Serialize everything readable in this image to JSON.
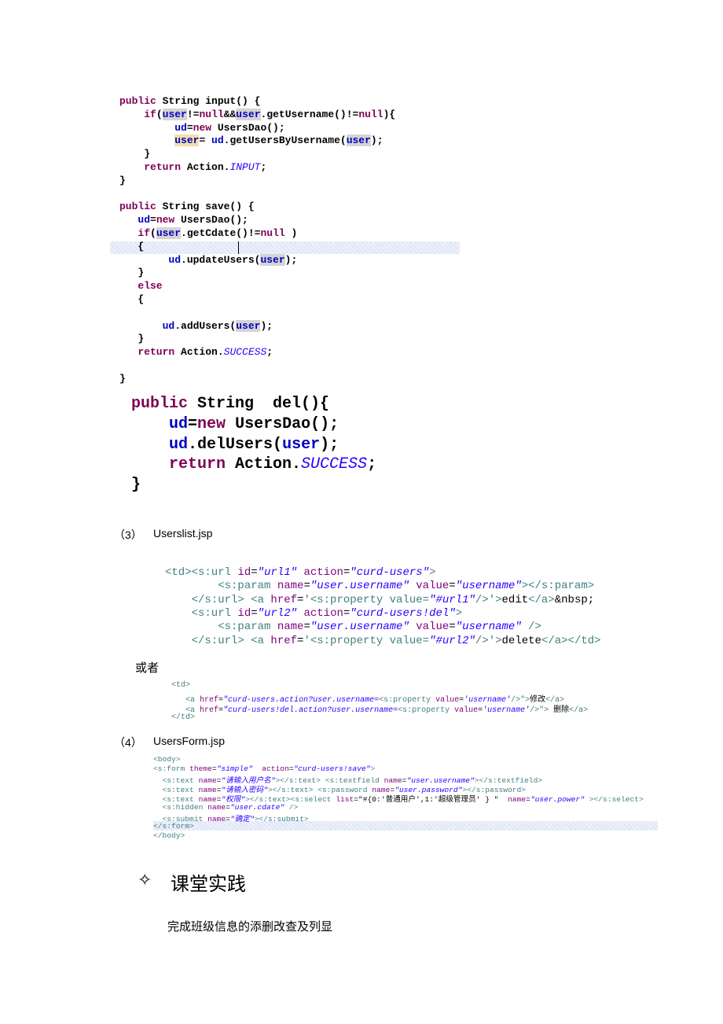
{
  "code_java_1": [
    [
      [
        "public",
        "kw"
      ],
      [
        " String input() {",
        "plain"
      ]
    ],
    [
      [
        "    ",
        "plain"
      ],
      [
        "if",
        "kw"
      ],
      [
        "(",
        "plain"
      ],
      [
        "user",
        "fld hl"
      ],
      [
        "!=",
        "plain"
      ],
      [
        "null",
        "kw"
      ],
      [
        "&&",
        "plain"
      ],
      [
        "user",
        "fld hl"
      ],
      [
        ".getUsername()!=",
        "plain"
      ],
      [
        "null",
        "kw"
      ],
      [
        "){",
        "plain"
      ]
    ],
    [
      [
        "         ",
        "plain"
      ],
      [
        "ud",
        "fld"
      ],
      [
        "=",
        "plain"
      ],
      [
        "new",
        "kw"
      ],
      [
        " UsersDao();",
        "plain"
      ]
    ],
    [
      [
        "         ",
        "plain"
      ],
      [
        "user",
        "fld hlo"
      ],
      [
        "= ",
        "plain"
      ],
      [
        "ud",
        "fld"
      ],
      [
        ".getUsersByUsername(",
        "plain"
      ],
      [
        "user",
        "fld hl"
      ],
      [
        ");",
        "plain"
      ]
    ],
    [
      [
        "    }",
        "plain"
      ]
    ],
    [
      [
        "    ",
        "plain"
      ],
      [
        "return",
        "kw"
      ],
      [
        " Action.",
        "plain"
      ],
      [
        "INPUT",
        "it"
      ],
      [
        ";",
        "plain"
      ]
    ],
    [
      [
        "}",
        "plain"
      ]
    ],
    [
      [
        "",
        "plain"
      ]
    ],
    [
      [
        "public",
        "kw"
      ],
      [
        " String save() {",
        "plain"
      ]
    ],
    [
      [
        "   ",
        "plain"
      ],
      [
        "ud",
        "fld"
      ],
      [
        "=",
        "plain"
      ],
      [
        "new",
        "kw"
      ],
      [
        " UsersDao();",
        "plain"
      ]
    ],
    [
      [
        "   ",
        "plain"
      ],
      [
        "if",
        "kw"
      ],
      [
        "(",
        "plain"
      ],
      [
        "user",
        "fld hl"
      ],
      [
        ".getCdate()!=",
        "plain"
      ],
      [
        "null",
        "kw"
      ],
      [
        " )",
        "plain"
      ]
    ],
    [
      [
        "   {",
        "plain"
      ]
    ],
    [
      [
        "        ",
        "plain"
      ],
      [
        "ud",
        "fld"
      ],
      [
        ".updateUsers(",
        "plain"
      ],
      [
        "user",
        "fld hl"
      ],
      [
        ");",
        "plain"
      ]
    ],
    [
      [
        "   }",
        "plain"
      ]
    ],
    [
      [
        "   ",
        "plain"
      ],
      [
        "else",
        "kw"
      ]
    ],
    [
      [
        "   {",
        "plain"
      ]
    ],
    [
      [
        "",
        "plain"
      ]
    ],
    [
      [
        "       ",
        "plain"
      ],
      [
        "ud",
        "fld"
      ],
      [
        ".addUsers(",
        "plain"
      ],
      [
        "user",
        "fld hl"
      ],
      [
        ");",
        "plain"
      ]
    ],
    [
      [
        "   }",
        "plain"
      ]
    ],
    [
      [
        "   ",
        "plain"
      ],
      [
        "return",
        "kw"
      ],
      [
        " Action.",
        "plain"
      ],
      [
        "SUCCESS",
        "it"
      ],
      [
        ";",
        "plain"
      ]
    ],
    [
      [
        "",
        "plain"
      ]
    ],
    [
      [
        "}",
        "plain"
      ]
    ]
  ],
  "code_java_del": [
    [
      [
        "public",
        "kw"
      ],
      [
        " String  del(){",
        "plain"
      ]
    ],
    [
      [
        "    ",
        "plain"
      ],
      [
        "ud",
        "fld"
      ],
      [
        "=",
        "plain"
      ],
      [
        "new",
        "kw"
      ],
      [
        " UsersDao();",
        "plain"
      ]
    ],
    [
      [
        "    ",
        "plain"
      ],
      [
        "ud",
        "fld"
      ],
      [
        ".delUsers(",
        "plain"
      ],
      [
        "user",
        "fld"
      ],
      [
        ");",
        "plain"
      ]
    ],
    [
      [
        "    ",
        "plain"
      ],
      [
        "return",
        "kw"
      ],
      [
        " Action.",
        "plain"
      ],
      [
        "SUCCESS",
        "it"
      ],
      [
        ";",
        "plain"
      ]
    ],
    [
      [
        "}",
        "plain"
      ]
    ]
  ],
  "section3": {
    "number": "（3）",
    "title": "Userslist.jsp"
  },
  "code_jsp_list": [
    [
      [
        "<td><s:url ",
        "tag"
      ],
      [
        "id",
        "attr"
      ],
      [
        "=",
        "plain"
      ],
      [
        "\"url1\"",
        "str"
      ],
      [
        " ",
        "plain"
      ],
      [
        "action",
        "attr"
      ],
      [
        "=",
        "plain"
      ],
      [
        "\"curd-users\"",
        "str"
      ],
      [
        ">",
        "tag"
      ]
    ],
    [
      [
        "        <s:param ",
        "tag"
      ],
      [
        "name",
        "attr"
      ],
      [
        "=",
        "plain"
      ],
      [
        "\"user.username\"",
        "str"
      ],
      [
        " ",
        "plain"
      ],
      [
        "value",
        "attr"
      ],
      [
        "=",
        "plain"
      ],
      [
        "\"username\"",
        "str"
      ],
      [
        "></s:param>",
        "tag"
      ]
    ],
    [
      [
        "    </s:url> <a ",
        "tag"
      ],
      [
        "href",
        "attr"
      ],
      [
        "=",
        "plain"
      ],
      [
        "'<s:property value=",
        "tag"
      ],
      [
        "\"#url1\"",
        "str"
      ],
      [
        "/>'",
        "tag"
      ],
      [
        ">",
        "tag"
      ],
      [
        "edit",
        "plain"
      ],
      [
        "</a>",
        "tag"
      ],
      [
        "&nbsp;",
        "plain"
      ]
    ],
    [
      [
        "    <s:url ",
        "tag"
      ],
      [
        "id",
        "attr"
      ],
      [
        "=",
        "plain"
      ],
      [
        "\"url2\"",
        "str"
      ],
      [
        " ",
        "plain"
      ],
      [
        "action",
        "attr"
      ],
      [
        "=",
        "plain"
      ],
      [
        "\"curd-users!del\"",
        "str"
      ],
      [
        ">",
        "tag"
      ]
    ],
    [
      [
        "        <s:param ",
        "tag"
      ],
      [
        "name",
        "attr"
      ],
      [
        "=",
        "plain"
      ],
      [
        "\"user.username\"",
        "str"
      ],
      [
        " ",
        "plain"
      ],
      [
        "value",
        "attr"
      ],
      [
        "=",
        "plain"
      ],
      [
        "\"username\"",
        "str"
      ],
      [
        " />",
        "tag"
      ]
    ],
    [
      [
        "    </s:url> <a ",
        "tag"
      ],
      [
        "href",
        "attr"
      ],
      [
        "=",
        "plain"
      ],
      [
        "'<s:property value=",
        "tag"
      ],
      [
        "\"#url2\"",
        "str"
      ],
      [
        "/>'",
        "tag"
      ],
      [
        ">",
        "tag"
      ],
      [
        "delete",
        "plain"
      ],
      [
        "</a></td>",
        "tag"
      ]
    ]
  ],
  "or_text": "或者",
  "code_jsp_alt": [
    [
      [
        "<td>",
        "tag"
      ]
    ],
    [
      [
        "   <a ",
        "tag"
      ],
      [
        "href",
        "attr"
      ],
      [
        "=",
        "plain"
      ],
      [
        "\"curd-users.action?user.username=",
        "str"
      ],
      [
        "<s:property ",
        "tag"
      ],
      [
        "value",
        "attr"
      ],
      [
        "=",
        "plain"
      ],
      [
        "'username'",
        "str"
      ],
      [
        "/>\">",
        "tag"
      ],
      [
        "修改",
        "plain"
      ],
      [
        "</a>",
        "tag"
      ]
    ],
    [
      [
        "   <a ",
        "tag"
      ],
      [
        "href",
        "attr"
      ],
      [
        "=",
        "plain"
      ],
      [
        "\"curd-users!del.action?user.username=",
        "str"
      ],
      [
        "<s:property ",
        "tag"
      ],
      [
        "value",
        "attr"
      ],
      [
        "=",
        "plain"
      ],
      [
        "'username'",
        "str"
      ],
      [
        "/>\"> ",
        "tag"
      ],
      [
        "删除",
        "plain"
      ],
      [
        "</a>",
        "tag"
      ]
    ],
    [
      [
        "</td>",
        "tag"
      ]
    ]
  ],
  "section4": {
    "number": "（4）",
    "title": "UsersForm.jsp"
  },
  "code_jsp_form": [
    [
      [
        "<body>",
        "tag"
      ]
    ],
    [
      [
        "<s:form ",
        "tag"
      ],
      [
        "theme",
        "attr"
      ],
      [
        "=",
        "plain"
      ],
      [
        "\"simple\"",
        "str"
      ],
      [
        "  ",
        "plain"
      ],
      [
        "action",
        "attr"
      ],
      [
        "=",
        "plain"
      ],
      [
        "\"curd-users!save\"",
        "str"
      ],
      [
        ">",
        "tag"
      ]
    ],
    [
      [
        "  <s:text ",
        "tag"
      ],
      [
        "name",
        "attr"
      ],
      [
        "=",
        "plain"
      ],
      [
        "\"请输入用户名\"",
        "str"
      ],
      [
        "></s:text> <s:textfield ",
        "tag"
      ],
      [
        "name",
        "attr"
      ],
      [
        "=",
        "plain"
      ],
      [
        "\"user.username\"",
        "str"
      ],
      [
        "></s:textfield>",
        "tag"
      ]
    ],
    [
      [
        "  <s:text ",
        "tag"
      ],
      [
        "name",
        "attr"
      ],
      [
        "=",
        "plain"
      ],
      [
        "\"请输入密码\"",
        "str"
      ],
      [
        "></s:text> <s:password ",
        "tag"
      ],
      [
        "name",
        "attr"
      ],
      [
        "=",
        "plain"
      ],
      [
        "\"user.password\"",
        "str"
      ],
      [
        "></s:password>",
        "tag"
      ]
    ],
    [
      [
        "  <s:text ",
        "tag"
      ],
      [
        "name",
        "attr"
      ],
      [
        "=",
        "plain"
      ],
      [
        "\"权限\"",
        "str"
      ],
      [
        "></s:text><s:select ",
        "tag"
      ],
      [
        "list",
        "attr"
      ],
      [
        "=",
        "plain"
      ],
      [
        "\"#{0:'普通用户',1:'超级管理员' } \"",
        "plain"
      ],
      [
        "  ",
        "plain"
      ],
      [
        "name",
        "attr"
      ],
      [
        "=",
        "plain"
      ],
      [
        "\"user.power\"",
        "str"
      ],
      [
        " ></s:select>",
        "tag"
      ]
    ],
    [
      [
        "  <s:hidden ",
        "tag"
      ],
      [
        "name",
        "attr"
      ],
      [
        "=",
        "plain"
      ],
      [
        "\"user.cdate\"",
        "str"
      ],
      [
        " />",
        "tag"
      ]
    ],
    [
      [
        "  <s:submit ",
        "tag"
      ],
      [
        "name",
        "attr"
      ],
      [
        "=",
        "plain"
      ],
      [
        "\"确定\"",
        "str"
      ],
      [
        "></s:submit>",
        "tag"
      ]
    ],
    [
      [
        "</s:form>",
        "tag"
      ]
    ],
    [
      [
        "</body>",
        "tag"
      ]
    ]
  ],
  "practice": {
    "icon": "diamond-star-icon",
    "symbol": "✧",
    "title": "课堂实践",
    "task": "完成班级信息的添删改查及列显"
  }
}
